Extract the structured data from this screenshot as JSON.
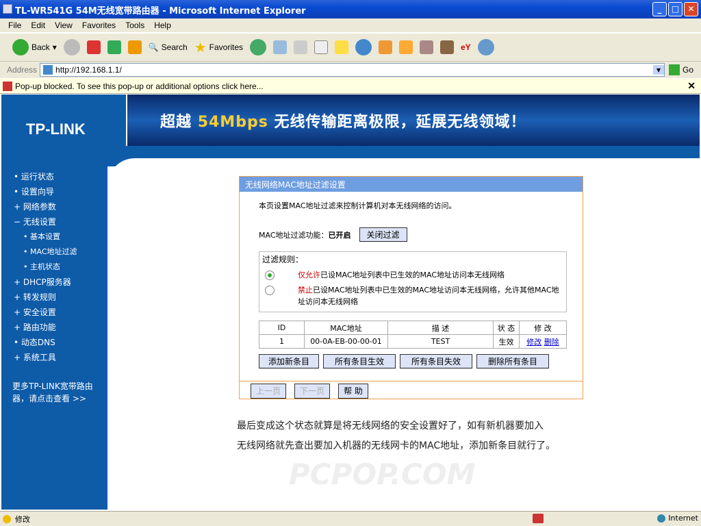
{
  "window": {
    "title": "TL-WR541G 54M无线宽带路由器 - Microsoft Internet Explorer"
  },
  "menu": [
    "File",
    "Edit",
    "View",
    "Favorites",
    "Tools",
    "Help"
  ],
  "toolbar": {
    "back": "Back",
    "search": "Search",
    "favorites": "Favorites"
  },
  "address": {
    "label": "Address",
    "url": "http://192.168.1.1/",
    "go": "Go"
  },
  "popup": {
    "text": "Pop-up blocked. To see this pop-up or additional options click here..."
  },
  "header": {
    "logo": "TP-LINK",
    "banner_pre": "超越",
    "banner_hl": "54Mbps",
    "banner_post": "无线传输距离极限，延展无线领域！"
  },
  "sidebar": {
    "items": [
      {
        "label": "运行状态",
        "bullet": "•"
      },
      {
        "label": "设置向导",
        "bullet": "•"
      },
      {
        "label": "网络参数",
        "bullet": "+"
      },
      {
        "label": "无线设置",
        "bullet": "−"
      },
      {
        "label": "基本设置",
        "bullet": "•"
      },
      {
        "label": "MAC地址过滤",
        "bullet": "•"
      },
      {
        "label": "主机状态",
        "bullet": "•"
      },
      {
        "label": "DHCP服务器",
        "bullet": "+"
      },
      {
        "label": "转发规则",
        "bullet": "+"
      },
      {
        "label": "安全设置",
        "bullet": "+"
      },
      {
        "label": "路由功能",
        "bullet": "+"
      },
      {
        "label": "动态DNS",
        "bullet": "•"
      },
      {
        "label": "系统工具",
        "bullet": "+"
      }
    ],
    "more": "更多TP-LINK宽带路由器，请点击查看 >>"
  },
  "panel": {
    "title": "无线网络MAC地址过滤设置",
    "desc": "本页设置MAC地址过滤来控制计算机对本无线网络的访问。",
    "status_label": "MAC地址过滤功能：",
    "status_value": "已开启",
    "toggle_btn": "关闭过滤",
    "rules_label": "过滤规则：",
    "rule1_hl": "仅允许",
    "rule1": "已设MAC地址列表中已生效的MAC地址访问本无线网络",
    "rule2_hl": "禁止",
    "rule2": "已设MAC地址列表中已生效的MAC地址访问本无线网络，允许其他MAC地址访问本无线网络",
    "table": {
      "headers": [
        "ID",
        "MAC地址",
        "描 述",
        "状 态",
        "修 改"
      ],
      "rows": [
        {
          "id": "1",
          "mac": "00-0A-EB-00-00-01",
          "desc": "TEST",
          "status": "生效",
          "edit": "修改",
          "delete": "删除"
        }
      ]
    },
    "buttons": [
      "添加新条目",
      "所有条目生效",
      "所有条目失效",
      "删除所有条目"
    ],
    "footer": {
      "prev": "上一页",
      "next": "下一页",
      "help": "帮 助"
    }
  },
  "note": [
    "最后变成这个状态就算是将无线网络的安全设置好了，如有新机器要加入",
    "无线网络就先查出要加入机器的无线网卡的MAC地址，添加新条目就行了。"
  ],
  "watermark": "PCPOP.COM",
  "statusbar": {
    "text": "修改",
    "zone": "Internet"
  }
}
